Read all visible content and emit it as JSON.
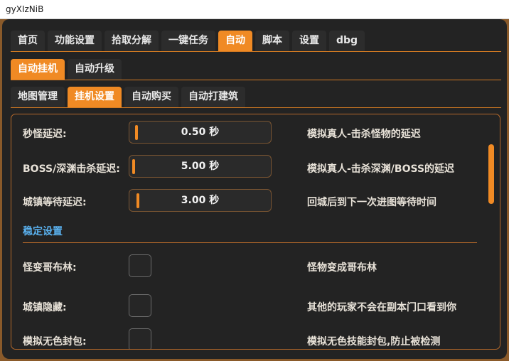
{
  "window": {
    "title": "gyXIzNiB"
  },
  "colors": {
    "accent": "#f08a24",
    "section": "#5ab2f0",
    "background": "#232323"
  },
  "tabs_main": [
    "首页",
    "功能设置",
    "拾取分解",
    "一键任务",
    "自动",
    "脚本",
    "设置",
    "dbg"
  ],
  "tabs_sub": [
    "自动挂机",
    "自动升级"
  ],
  "tabs_third": [
    "地图管理",
    "挂机设置",
    "自动购买",
    "自动打建筑"
  ],
  "sliders": [
    {
      "label": "秒怪延迟:",
      "value": "0.50 秒",
      "description": "模拟真人-击杀怪物的延迟",
      "level": 0.02
    },
    {
      "label": "BOSS/深渊击杀延迟:",
      "value": "5.00 秒",
      "description": "模拟真人-击杀深渊/BOSS的延迟",
      "level": 0.0
    },
    {
      "label": "城镇等待延迟:",
      "value": "3.00 秒",
      "description": "回城后到下一次进图等待时间",
      "level": 0.03
    }
  ],
  "section": {
    "title": "稳定设置"
  },
  "checkboxes": [
    {
      "label": "怪变哥布林:",
      "description": "怪物变成哥布林",
      "checked": false
    },
    {
      "label": "城镇隐藏:",
      "description": "其他的玩家不会在副本门口看到你",
      "checked": false
    },
    {
      "label": "模拟无色封包:",
      "description": "模拟无色技能封包,防止被检测",
      "checked": false
    }
  ]
}
